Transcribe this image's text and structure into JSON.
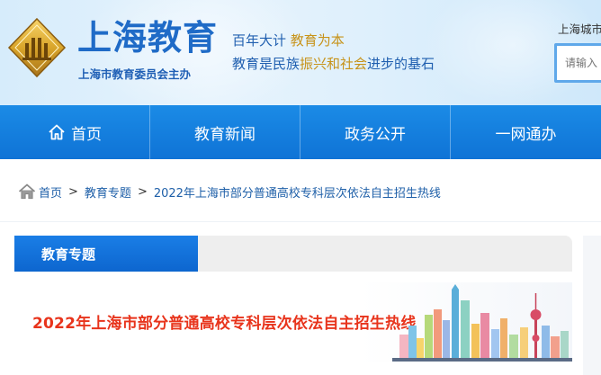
{
  "header": {
    "site_title": "上海教育",
    "site_subtitle": "上海市教育委员会主办",
    "slogan_line1_part1": "百年大计 ",
    "slogan_line1_part2": "教育为本",
    "slogan_line2_part1": "教育是民族",
    "slogan_line2_part2": "振兴和社会",
    "slogan_line2_part3": "进步的基石",
    "city_label": "上海城市",
    "search_placeholder": "请输入"
  },
  "nav": {
    "items": [
      {
        "label": "首页",
        "icon": "home-icon"
      },
      {
        "label": "教育新闻"
      },
      {
        "label": "政务公开"
      },
      {
        "label": "一网通办"
      }
    ]
  },
  "breadcrumb": {
    "items": [
      "首页",
      "教育专题",
      "2022年上海市部分普通高校专科层次依法自主招生热线"
    ],
    "separator": ">"
  },
  "section": {
    "tab_label": "教育专题",
    "banner_title": "2022年上海市部分普通高校专科层次依法自主招生热线"
  },
  "colors": {
    "brand_blue": "#1f6bc7",
    "nav_blue": "#0f73d6",
    "gold": "#c7931a",
    "banner_red": "#e8341c"
  }
}
